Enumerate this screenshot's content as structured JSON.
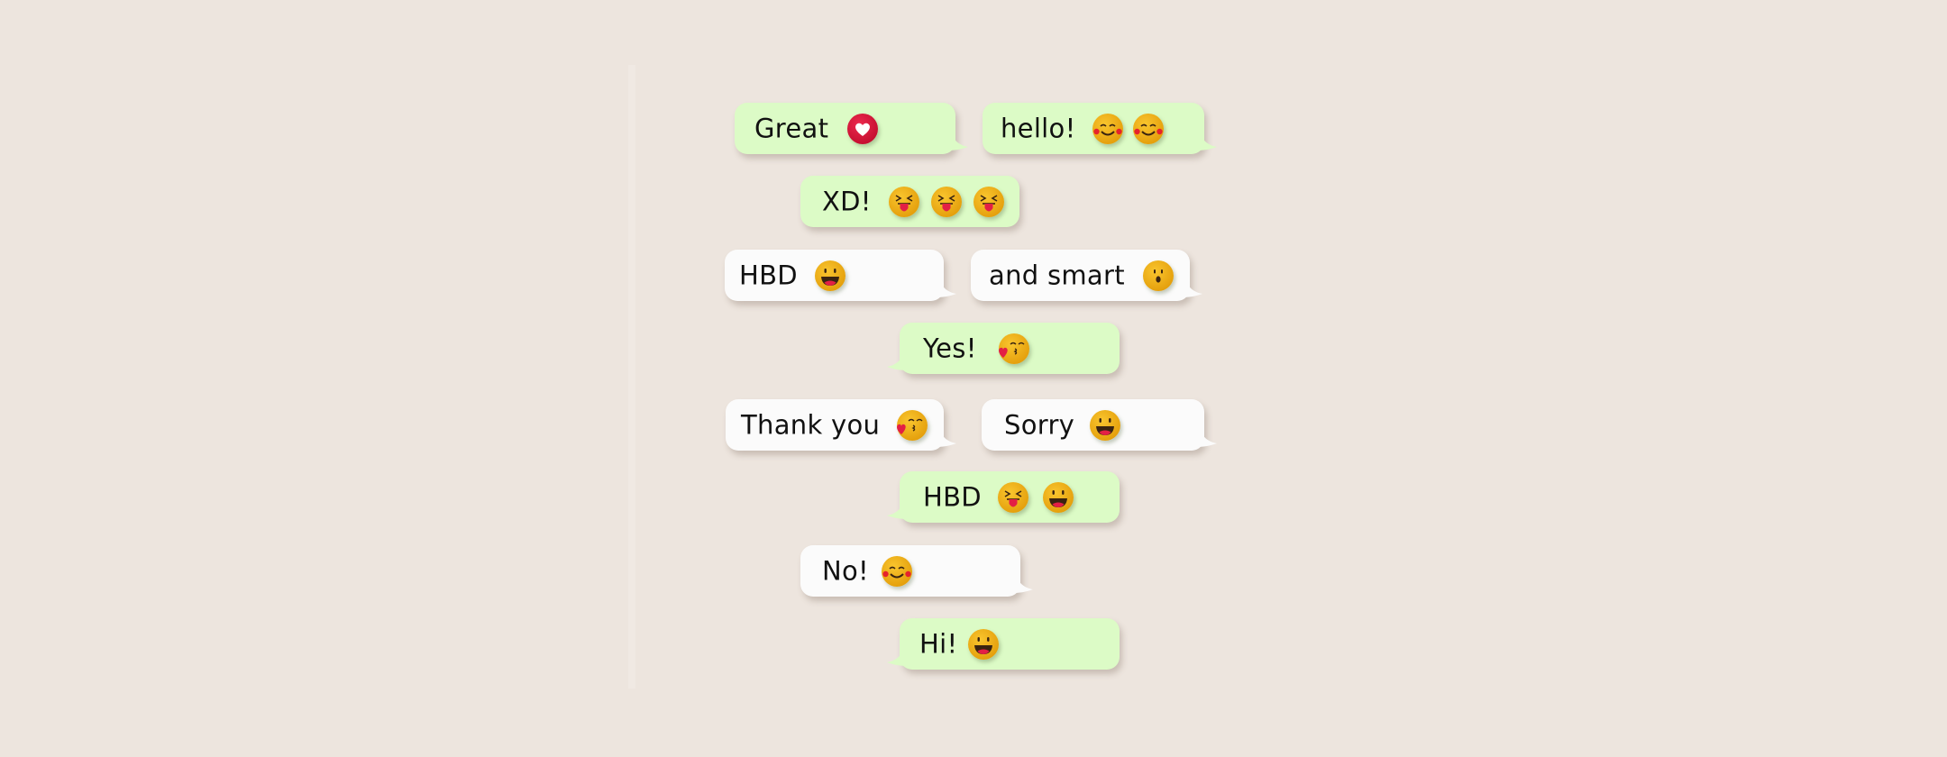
{
  "colors": {
    "background": "#ede5de",
    "bubble_green": "#dcfbc6",
    "bubble_white": "#fbfbfb",
    "emoji_yellow": "#f2b11a",
    "heart_red": "#d8143a",
    "text": "#111111"
  },
  "messages": [
    {
      "text": "Great",
      "style": "green",
      "tail": "right",
      "emojis": [
        "heart-icon"
      ]
    },
    {
      "text": "hello!",
      "style": "green",
      "tail": "right",
      "emojis": [
        "blushing-smile-icon",
        "blushing-smile-icon"
      ]
    },
    {
      "text": "XD!",
      "style": "green",
      "tail": "none",
      "emojis": [
        "squinting-tongue-icon",
        "squinting-tongue-icon",
        "squinting-tongue-icon"
      ]
    },
    {
      "text": "HBD",
      "style": "white",
      "tail": "right",
      "emojis": [
        "grinning-face-icon"
      ]
    },
    {
      "text": "and smart",
      "style": "white",
      "tail": "right",
      "emojis": [
        "surprised-face-icon"
      ]
    },
    {
      "text": "Yes!",
      "style": "green",
      "tail": "left",
      "emojis": [
        "kissing-face-icon"
      ]
    },
    {
      "text": "Thank you",
      "style": "white",
      "tail": "right",
      "emojis": [
        "kissing-face-icon"
      ]
    },
    {
      "text": "Sorry",
      "style": "white",
      "tail": "right",
      "emojis": [
        "grinning-face-icon"
      ]
    },
    {
      "text": "HBD",
      "style": "green",
      "tail": "left",
      "emojis": [
        "squinting-tongue-icon",
        "grinning-face-icon"
      ]
    },
    {
      "text": "No!",
      "style": "white",
      "tail": "right",
      "emojis": [
        "blushing-smile-icon"
      ]
    },
    {
      "text": "Hi!",
      "style": "green",
      "tail": "left",
      "emojis": [
        "grinning-face-icon"
      ]
    }
  ]
}
